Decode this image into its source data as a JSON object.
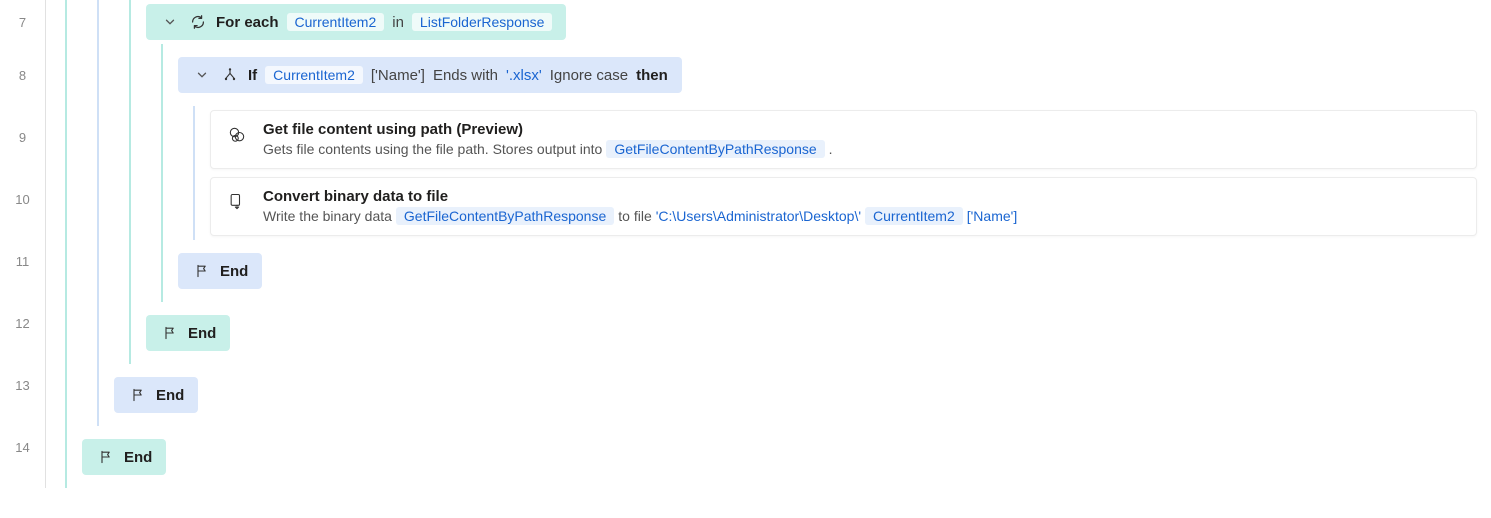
{
  "line_numbers": [
    "7",
    "8",
    "9",
    "10",
    "11",
    "12",
    "13",
    "14"
  ],
  "foreach": {
    "keyword": "For each",
    "item_var": "CurrentItem2",
    "in": "in",
    "collection_var": "ListFolderResponse"
  },
  "if": {
    "keyword": "If",
    "var": "CurrentItem2",
    "accessor": "['Name']",
    "op": "Ends with",
    "value": "'.xlsx'",
    "modifier": "Ignore case",
    "then": "then"
  },
  "action_getfile": {
    "title": "Get file content using path (Preview)",
    "desc_prefix": "Gets file contents using the file path. Stores output into",
    "output_var": "GetFileContentByPathResponse",
    "desc_suffix": "."
  },
  "action_convert": {
    "title": "Convert binary data to file",
    "desc_prefix": "Write the binary data",
    "input_var": "GetFileContentByPathResponse",
    "mid": "to file",
    "path_literal": "'C:\\Users\\Administrator\\Desktop\\'",
    "item_var": "CurrentItem2",
    "accessor": "['Name']"
  },
  "end": {
    "label": "End"
  }
}
